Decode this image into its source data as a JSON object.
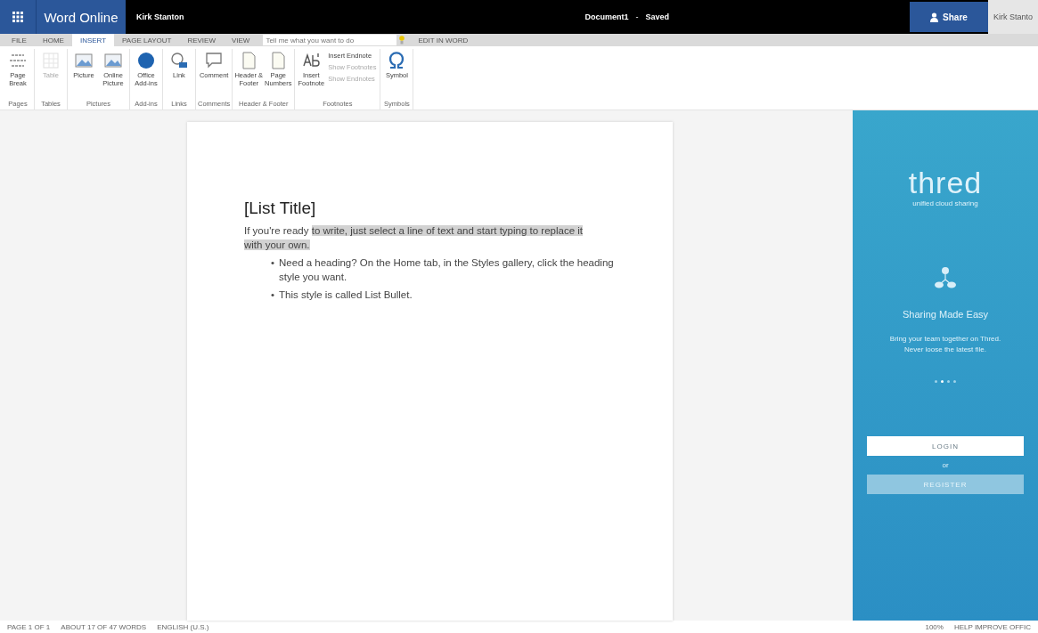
{
  "app_bar": {
    "app_name": "Word Online",
    "user": "Kirk Stanton",
    "document": "Document1",
    "separator": "-",
    "save_state": "Saved",
    "share": "Share",
    "account": "Kirk Stanto"
  },
  "tabs": [
    {
      "label": "FILE",
      "selected": false
    },
    {
      "label": "HOME",
      "selected": false
    },
    {
      "label": "INSERT",
      "selected": true
    },
    {
      "label": "PAGE LAYOUT",
      "selected": false
    },
    {
      "label": "REVIEW",
      "selected": false
    },
    {
      "label": "VIEW",
      "selected": false
    }
  ],
  "tell_me": {
    "placeholder": "Tell me what you want to do"
  },
  "edit_in_word": "EDIT IN WORD",
  "ribbon": [
    {
      "group": "Pages",
      "buttons": [
        {
          "label": "Page Break",
          "disabled": false
        }
      ]
    },
    {
      "group": "Tables",
      "buttons": [
        {
          "label": "Table",
          "disabled": true
        }
      ]
    },
    {
      "group": "Pictures",
      "buttons": [
        {
          "label": "Picture",
          "disabled": false
        },
        {
          "label": "Online Picture",
          "disabled": false
        }
      ]
    },
    {
      "group": "Add-ins",
      "buttons": [
        {
          "label": "Office Add-ins",
          "disabled": false
        }
      ]
    },
    {
      "group": "Links",
      "buttons": [
        {
          "label": "Link",
          "disabled": false
        }
      ]
    },
    {
      "group": "Comments",
      "buttons": [
        {
          "label": "Comment",
          "disabled": false
        }
      ]
    },
    {
      "group": "Header & Footer",
      "buttons": [
        {
          "label": "Header & Footer",
          "disabled": false
        },
        {
          "label": "Page Numbers",
          "disabled": false
        }
      ]
    },
    {
      "group": "Footnotes",
      "buttons": [
        {
          "label": "Insert Footnote",
          "disabled": false
        }
      ],
      "small_buttons": [
        {
          "label": "Insert Endnote",
          "disabled": false
        },
        {
          "label": "Show Footnotes",
          "disabled": true
        },
        {
          "label": "Show Endnotes",
          "disabled": true
        }
      ]
    },
    {
      "group": "Symbols",
      "buttons": [
        {
          "label": "Symbol",
          "disabled": false
        }
      ]
    }
  ],
  "document": {
    "title": "[List Title]",
    "paragraph": [
      {
        "text": "If you're ready ",
        "highlighted": false
      },
      {
        "text": "to write, just select a line of text and start typing to replace it with your own.",
        "highlighted": true
      }
    ],
    "bullets": [
      {
        "marker": "•",
        "text": "Need a heading? On the Home tab, in the Styles gallery, click the heading style you want."
      },
      {
        "marker": "•",
        "text": "This style is called List Bullet."
      }
    ]
  },
  "side_panel": {
    "logo": "thred",
    "tagline": "unified cloud sharing",
    "headline": "Sharing Made Easy",
    "description": "Bring your team together on Thred. Never loose the latest file.",
    "pages": [
      {
        "selected": false
      },
      {
        "selected": true
      },
      {
        "selected": false
      },
      {
        "selected": false
      }
    ],
    "login": "LOGIN",
    "or": "or",
    "register": "REGISTER"
  },
  "status_bar": {
    "page": "PAGE 1 OF 1",
    "words": "ABOUT 17 OF 47 WORDS",
    "language": "ENGLISH (U.S.)",
    "zoom": "100%",
    "help": "HELP IMPROVE OFFIC"
  }
}
